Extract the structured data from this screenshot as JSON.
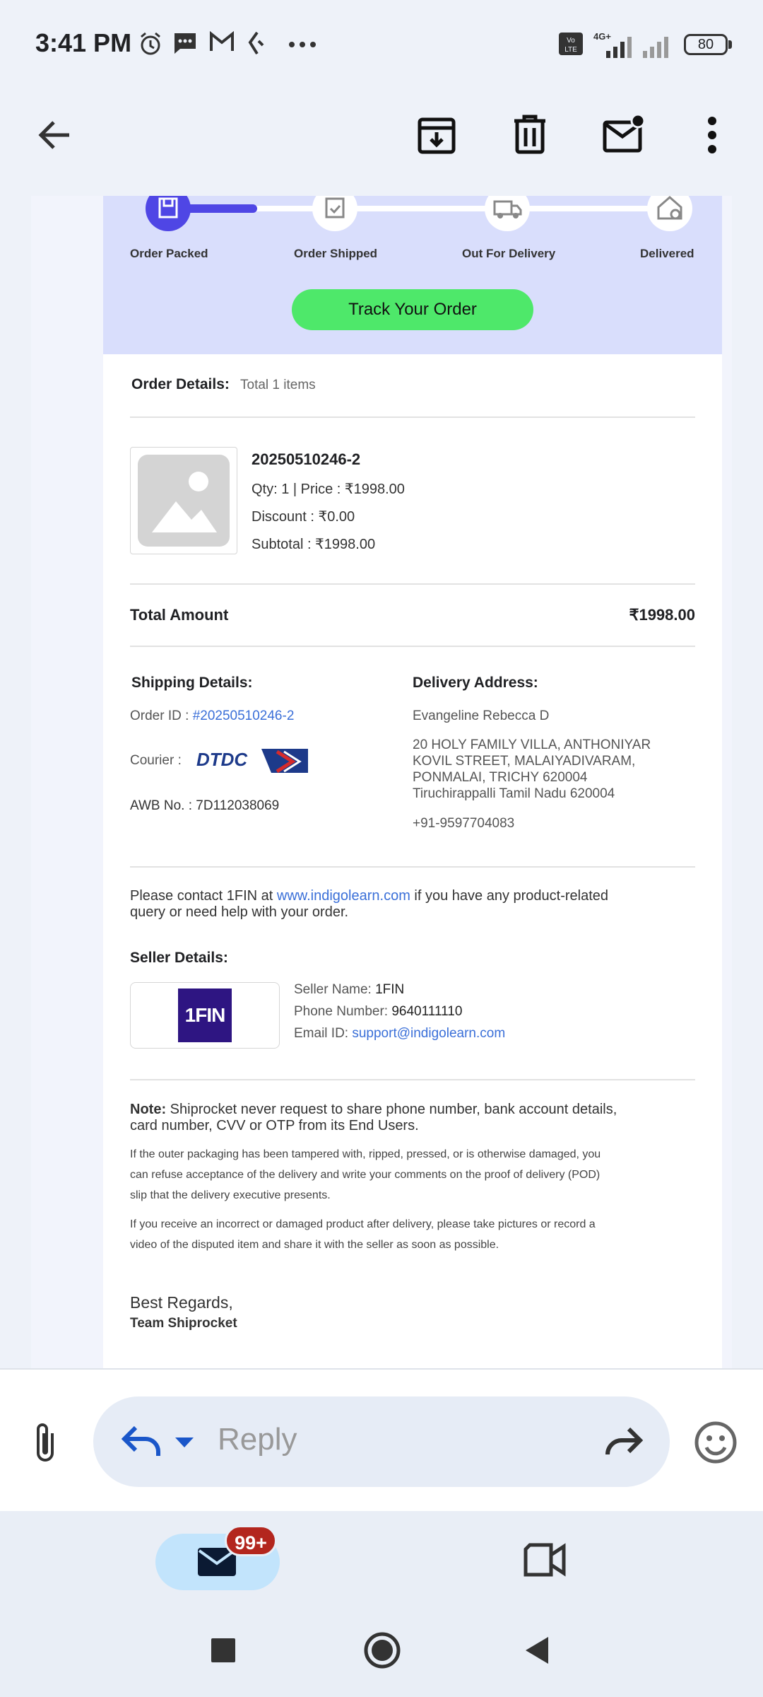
{
  "status_bar": {
    "time": "3:41 PM",
    "battery": "80",
    "network": "4G+"
  },
  "tracker": {
    "steps": [
      "Order Packed",
      "Order Shipped",
      "Out For Delivery",
      "Delivered"
    ],
    "button": "Track Your Order"
  },
  "order": {
    "heading": "Order Details:",
    "total_items": "Total 1 items",
    "item_id": "20250510246-2",
    "qty_price": "Qty: 1 | Price : ₹1998.00",
    "discount": "Discount : ₹0.00",
    "subtotal": "Subtotal : ₹1998.00",
    "total_label": "Total Amount",
    "total_value": "₹1998.00"
  },
  "shipping": {
    "heading": "Shipping Details:",
    "order_id_label": "Order ID : ",
    "order_id": "#20250510246-2",
    "courier_label": "Courier :",
    "courier_logo": "DTDC",
    "awb": "AWB No. : 7D112038069"
  },
  "delivery": {
    "heading": "Delivery Address:",
    "name": "Evangeline Rebecca D",
    "address_lines": [
      "20 HOLY FAMILY VILLA, ANTHONIYAR",
      "KOVIL STREET, MALAIYADIVARAM,",
      "PONMALAI, TRICHY 620004",
      "Tiruchirappalli Tamil Nadu 620004"
    ],
    "phone": "+91-9597704083"
  },
  "contact": {
    "pre": "Please contact 1FIN at ",
    "link": "www.indigolearn.com",
    "post": " if you have any product-related",
    "line2": "query or need help with your order."
  },
  "seller": {
    "heading": "Seller Details:",
    "logo_text": "1FIN",
    "name_label": "Seller Name: ",
    "name": "1FIN",
    "phone_label": "Phone Number: ",
    "phone": "9640111110",
    "email_label": "Email ID: ",
    "email": "support@indigolearn.com"
  },
  "note": {
    "label": "Note:",
    "line1": " Shiprocket never request to share phone number, bank account details,",
    "line2": "card number, CVV or OTP from its End Users.",
    "para1": [
      "If the outer packaging has been tampered with, ripped, pressed, or is otherwise damaged, you",
      "can refuse acceptance of the delivery and write your comments on the proof of delivery (POD)",
      "slip that the delivery executive presents."
    ],
    "para2": [
      "If you receive an incorrect or damaged product after delivery, please take pictures or record a",
      "video of the disputed item and share it with the seller as soon as possible."
    ]
  },
  "signoff": {
    "regards": "Best Regards,",
    "team": "Team Shiprocket"
  },
  "reply": {
    "placeholder": "Reply"
  },
  "bottom_nav": {
    "mail_badge": "99+"
  },
  "colors": {
    "accent": "#4f46e5",
    "track_button": "#4ee86a",
    "tracker_bg": "#d9defc",
    "link": "#3a6fd8",
    "badge": "#b3261e"
  }
}
